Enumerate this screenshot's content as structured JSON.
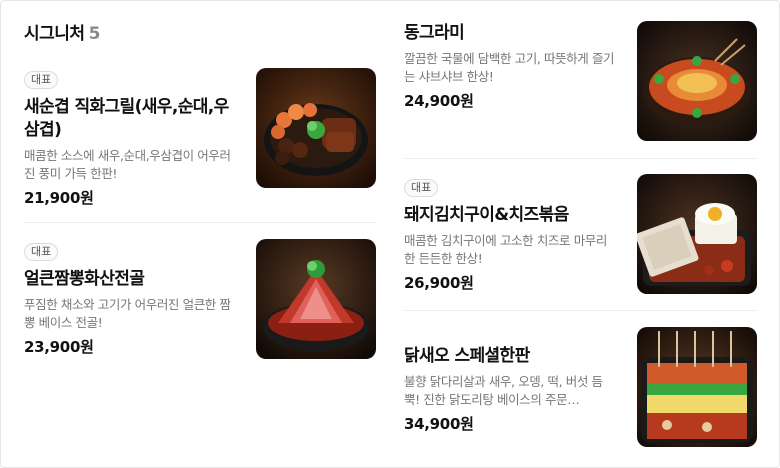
{
  "section": {
    "title": "시그니처",
    "count": "5"
  },
  "menu": [
    {
      "badge": "대표",
      "name": "새순겹 직화그릴(새우,순대,우삼겹)",
      "desc": "매콤한 소스에 새우,순대,우삼겹이 어우러진 풍미 가득 한판!",
      "price": "21,900원",
      "image": "grilled-shrimp-sundae-platter"
    },
    {
      "badge": "대표",
      "name": "얼큰짬뽕화산전골",
      "desc": "푸짐한 채소와 고기가 어우러진 얼큰한 짬뽕 베이스 전골!",
      "price": "23,900원",
      "image": "volcano-jjamppong-hotpot"
    },
    {
      "badge": "",
      "name": "동그라미",
      "desc": "깔끔한 국물에 담백한 고기, 따뜻하게 즐기는 샤브샤브 한상!",
      "price": "24,900원",
      "image": "shabu-shabu-round-pot"
    },
    {
      "badge": "대표",
      "name": "돼지김치구이&치즈볶음",
      "desc": "매콤한 김치구이에 고소한 치즈로 마무리한 든든한 한상!",
      "price": "26,900원",
      "image": "pork-kimchi-cheese-egg"
    },
    {
      "badge": "",
      "name": "닭새오 스페셜한판",
      "desc": "불향 닭다리살과 새우, 오뎅, 떡, 버섯 듬뿍! 진한 닭도리탕 베이스의 주문…",
      "price": "34,900원",
      "image": "chicken-shrimp-skewer-platter"
    }
  ]
}
